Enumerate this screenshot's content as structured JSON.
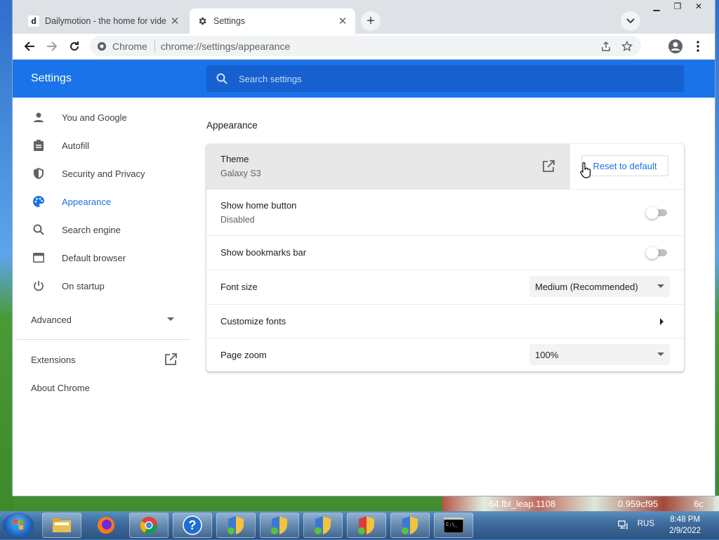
{
  "browser": {
    "tabs": [
      {
        "title": "Dailymotion - the home for vide",
        "favicon_letter": "d",
        "active": false
      },
      {
        "title": "Settings",
        "active": true
      }
    ],
    "omnibox": {
      "chip": "Chrome",
      "url": "chrome://settings/appearance"
    }
  },
  "settings": {
    "brand": "Settings",
    "search_placeholder": "Search settings",
    "sidebar": {
      "items": [
        {
          "label": "You and Google",
          "icon": "person-icon"
        },
        {
          "label": "Autofill",
          "icon": "clipboard-icon"
        },
        {
          "label": "Security and Privacy",
          "icon": "shield-icon"
        },
        {
          "label": "Appearance",
          "icon": "palette-icon",
          "selected": true
        },
        {
          "label": "Search engine",
          "icon": "search-icon"
        },
        {
          "label": "Default browser",
          "icon": "browser-window-icon"
        },
        {
          "label": "On startup",
          "icon": "power-icon"
        }
      ],
      "advanced": "Advanced",
      "extensions": "Extensions",
      "about": "About Chrome"
    },
    "section_title": "Appearance",
    "rows": {
      "theme": {
        "label": "Theme",
        "value": "Galaxy S3",
        "reset": "Reset to default"
      },
      "home_button": {
        "label": "Show home button",
        "value": "Disabled",
        "enabled": false
      },
      "bookmarks_bar": {
        "label": "Show bookmarks bar",
        "enabled": false
      },
      "font_size": {
        "label": "Font size",
        "value": "Medium (Recommended)"
      },
      "customize_fonts": {
        "label": "Customize fonts"
      },
      "page_zoom": {
        "label": "Page zoom",
        "value": "100%"
      }
    },
    "accent_color": "#1a73e8"
  },
  "desktop": {
    "overlay_text": "64.fbl_leap.1108",
    "overlay_text_2": "0.959cf95",
    "overlay_text_3": "6c"
  },
  "taskbar": {
    "language": "RUS",
    "time": "8:48 PM",
    "date": "2/9/2022"
  }
}
